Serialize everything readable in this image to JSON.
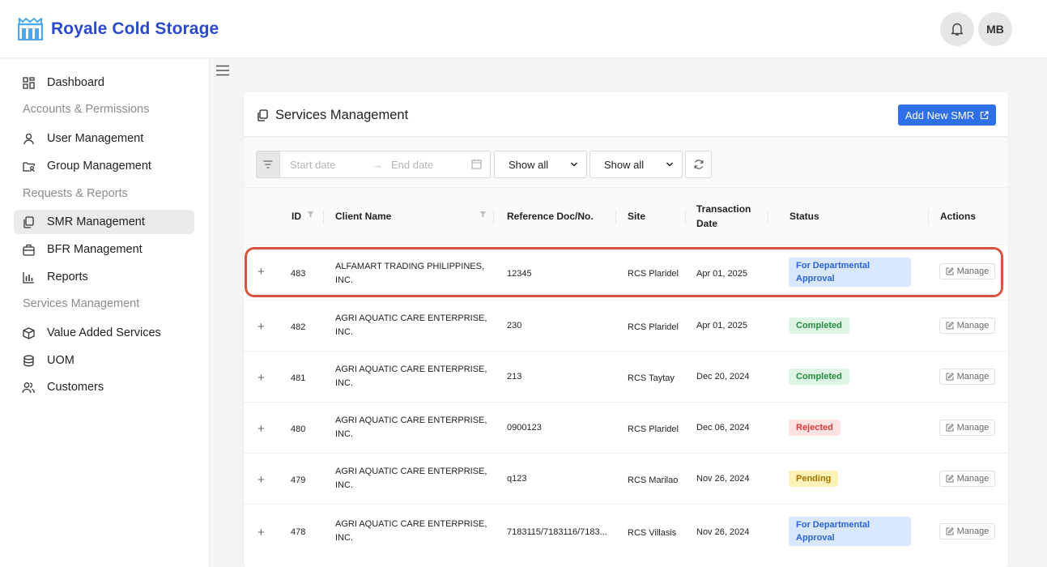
{
  "app": {
    "title": "Royale Cold Storage",
    "avatar_initials": "MB",
    "accent": "#2f6fe8",
    "logo_color": "#2b4acb"
  },
  "sidebar": {
    "items": [
      {
        "label": "Dashboard",
        "icon": "dashboard-icon"
      },
      {
        "label": "User Management",
        "icon": "user-icon"
      },
      {
        "label": "Group Management",
        "icon": "folder-user-icon"
      },
      {
        "label": "SMR Management",
        "icon": "copy-icon",
        "active": true
      },
      {
        "label": "BFR Management",
        "icon": "briefcase-icon"
      },
      {
        "label": "Reports",
        "icon": "bar-chart-icon"
      },
      {
        "label": "Value Added Services",
        "icon": "cube-icon"
      },
      {
        "label": "UOM",
        "icon": "database-icon"
      },
      {
        "label": "Customers",
        "icon": "users-icon"
      }
    ],
    "groups": [
      "Accounts & Permissions",
      "Requests & Reports",
      "Services Management"
    ]
  },
  "page": {
    "title": "Services Management",
    "add_button": "Add New SMR"
  },
  "filters": {
    "start_placeholder": "Start date",
    "end_placeholder": "End date",
    "arrow": "→",
    "select1": "Show all",
    "select2": "Show all"
  },
  "table": {
    "columns": {
      "id": "ID",
      "client": "Client Name",
      "ref": "Reference Doc/No.",
      "site": "Site",
      "date_line1": "Transaction",
      "date_line2": "Date",
      "status": "Status",
      "actions": "Actions"
    },
    "manage_label": "Manage",
    "rows": [
      {
        "expand": "+",
        "id": "483",
        "client_line1": "ALFAMART TRADING PHILIPPINES,",
        "client_line2": "INC.",
        "ref": "12345",
        "site": "RCS Plaridel",
        "date": "Apr 01, 2025",
        "status_line1": "For Departmental",
        "status_line2": "Approval"
      },
      {
        "expand": "+",
        "id": "482",
        "client_line1": "AGRI AQUATIC CARE ENTERPRISE,",
        "client_line2": "INC.",
        "ref": "230",
        "site": "RCS Plaridel",
        "date": "Apr 01, 2025",
        "status": "Completed"
      },
      {
        "expand": "+",
        "id": "481",
        "client_line1": "AGRI AQUATIC CARE ENTERPRISE,",
        "client_line2": "INC.",
        "ref": "213",
        "site": "RCS Taytay",
        "date": "Dec 20, 2024",
        "status": "Completed"
      },
      {
        "expand": "+",
        "id": "480",
        "client_line1": "AGRI AQUATIC CARE ENTERPRISE,",
        "client_line2": "INC.",
        "ref": "0900123",
        "site": "RCS Plaridel",
        "date": "Dec 06, 2024",
        "status": "Rejected"
      },
      {
        "expand": "+",
        "id": "479",
        "client_line1": "AGRI AQUATIC CARE ENTERPRISE,",
        "client_line2": "INC.",
        "ref": "q123",
        "site": "RCS Marilao",
        "date": "Nov 26, 2024",
        "status": "Pending"
      },
      {
        "expand": "+",
        "id": "478",
        "client_line1": "AGRI AQUATIC CARE ENTERPRISE,",
        "client_line2": "INC.",
        "ref": "7183115/7183116/7183...",
        "site": "RCS Villasis",
        "date": "Nov 26, 2024",
        "status_line1": "For Departmental",
        "status_line2": "Approval"
      }
    ]
  }
}
